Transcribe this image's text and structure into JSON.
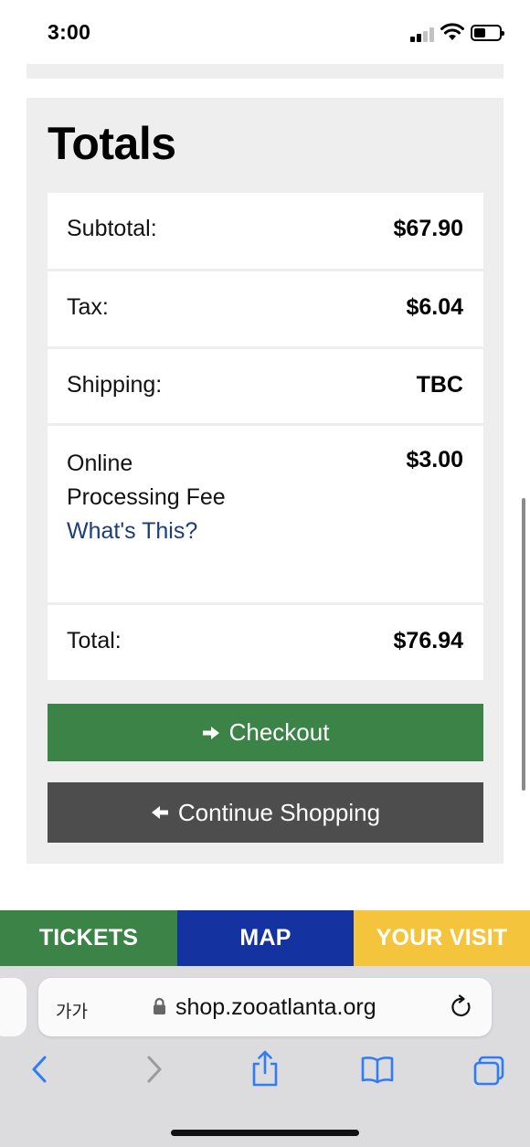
{
  "status_bar": {
    "time": "3:00"
  },
  "totals": {
    "title": "Totals",
    "rows": [
      {
        "label": "Subtotal:",
        "value": "$67.90"
      },
      {
        "label": "Tax:",
        "value": "$6.04"
      },
      {
        "label": "Shipping:",
        "value": "TBC"
      },
      {
        "label": "Online Processing Fee",
        "link": "What's This?",
        "value": "$3.00"
      },
      {
        "label": "Total:",
        "value": "$76.94"
      }
    ]
  },
  "buttons": {
    "checkout": "Checkout",
    "continue_shopping": "Continue Shopping"
  },
  "nav": {
    "tickets": "TICKETS",
    "map": "MAP",
    "your_visit": "YOUR VISIT"
  },
  "browser": {
    "text_size_label": "가가",
    "url": "shop.zooatlanta.org"
  },
  "icons": {
    "checkout": "arrow-right-icon",
    "continue": "arrow-left-icon",
    "lock": "lock-icon",
    "reload": "reload-icon",
    "back": "chevron-left-icon",
    "forward": "chevron-right-icon",
    "share": "share-icon",
    "bookmarks": "book-icon",
    "tabs": "tabs-icon"
  },
  "colors": {
    "green": "#3b8347",
    "dark_gray": "#4d4d4d",
    "navy": "#1433a0",
    "yellow": "#f4c53c",
    "link": "#1c3d78",
    "safari_blue": "#2f7cf6"
  }
}
